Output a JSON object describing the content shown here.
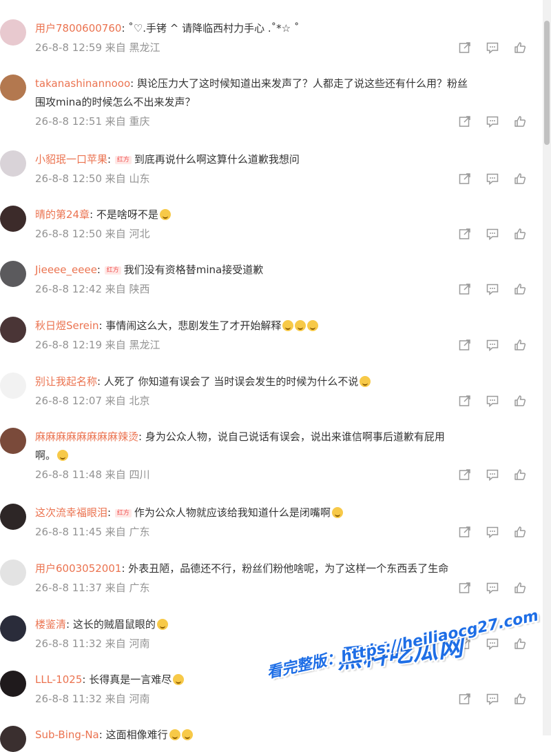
{
  "comments": [
    {
      "user": "用户7800600760",
      "badge": "",
      "content": "˚♡.手铐 ^ 请降临西村力手心 .˚*☆ ˚",
      "content2": "",
      "emoji": 0,
      "time": "26-8-8 12:59 来自 黑龙江",
      "avatar": "#e8c9cf"
    },
    {
      "user": "takanashinannooo",
      "badge": "",
      "content": "舆论压力大了这时候知道出来发声了？人都走了说这些还有什么用？粉丝",
      "content2": "围攻mina的时候怎么不出来发声？",
      "emoji": 0,
      "time": "26-8-8 12:51 来自 重庆",
      "avatar": "#b3784f"
    },
    {
      "user": "小貂珉一口苹果",
      "badge": "红方",
      "content": "到底再说什么啊这算什么道歉我想问",
      "content2": "",
      "emoji": 0,
      "time": "26-8-8 12:50 来自 山东",
      "avatar": "#d9d3d8"
    },
    {
      "user": "晴的第24章",
      "badge": "",
      "content": "不是啥呀不是",
      "content2": "",
      "emoji": 1,
      "time": "26-8-8 12:50 来自 河北",
      "avatar": "#3c2b2a"
    },
    {
      "user": "Jieeee_eeee",
      "badge": "红方",
      "content": "我们没有资格替mina接受道歉",
      "content2": "",
      "emoji": 0,
      "time": "26-8-8 12:42 来自 陕西",
      "avatar": "#5b5a5d"
    },
    {
      "user": "秋日煜Serein",
      "badge": "",
      "content": "事情闹这么大，悲剧发生了才开始解释",
      "content2": "",
      "emoji": 3,
      "time": "26-8-8 12:19 来自 黑龙江",
      "avatar": "#4a3536"
    },
    {
      "user": "别让我起名称",
      "badge": "",
      "content": "人死了 你知道有误会了 当时误会发生的时候为什么不说",
      "content2": "",
      "emoji": 1,
      "time": "26-8-8 12:07 来自 北京",
      "avatar": "#f2f2f2"
    },
    {
      "user": "麻麻麻麻麻麻麻麻辣烫",
      "badge": "",
      "content": "身为公众人物，说自己说话有误会，说出来谁信啊事后道歉有屁用",
      "content2": "啊。",
      "emoji": 1,
      "time": "26-8-8 11:48 来自 四川",
      "avatar": "#7a4a3a"
    },
    {
      "user": "这次流幸福眼泪",
      "badge": "红方",
      "content": "作为公众人物就应该给我知道什么是闭嘴啊",
      "content2": "",
      "emoji": 1,
      "time": "26-8-8 11:45 来自 广东",
      "avatar": "#2d2626"
    },
    {
      "user": "用户6003052001",
      "badge": "",
      "content": "外表丑陋，品德还不行，粉丝们粉他啥呢，为了这样一个东西丢了生命",
      "content2": "",
      "emoji": 0,
      "time": "26-8-8 11:37 来自 广东",
      "avatar": "#e3e3e3"
    },
    {
      "user": "楼鉴清",
      "badge": "",
      "content": "这长的贼眉鼠眼的",
      "content2": "",
      "emoji": 1,
      "time": "26-8-8 11:32 来自 河南",
      "avatar": "#2a2c3a"
    },
    {
      "user": "LLL-1025",
      "badge": "",
      "content": "长得真是一言难尽",
      "content2": "",
      "emoji": 1,
      "time": "26-8-8 11:32 来自 河南",
      "avatar": "#1f1a1c"
    },
    {
      "user": "Sub-Bing-Na",
      "badge": "",
      "content": "这面相像难行",
      "content2": "",
      "emoji": 2,
      "time": "",
      "avatar": "#3a2f2f"
    }
  ],
  "watermark": {
    "title": "黑料吃瓜网",
    "url": "看完整版：https://heiliaocg27.com"
  },
  "colors": {
    "username": "#eb7350",
    "meta": "#939393",
    "text": "#333333"
  },
  "icons": {
    "share": "share-icon",
    "comment": "comment-icon",
    "like": "like-icon"
  }
}
